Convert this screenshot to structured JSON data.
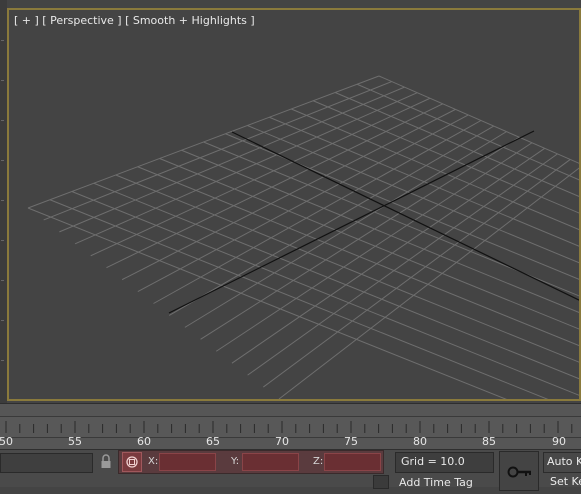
{
  "viewport": {
    "label": "[ + ] [ Perspective ] [ Smooth + Highlights ]"
  },
  "timeline": {
    "ticks": [
      "50",
      "55",
      "60",
      "65",
      "70",
      "75",
      "80",
      "85",
      "90"
    ]
  },
  "status_bar": {
    "coords": {
      "x_label": "X:",
      "x_value": "",
      "y_label": "Y:",
      "y_value": "",
      "z_label": "Z:",
      "z_value": ""
    },
    "grid_label": "Grid = 10.0",
    "add_time_tag": "Add Time Tag",
    "auto_key": "Auto Key",
    "set_key": "Set Key"
  },
  "colors": {
    "viewport_border": "#8a7a3c",
    "background": "#444444",
    "coord_field": "#6a2f33"
  }
}
